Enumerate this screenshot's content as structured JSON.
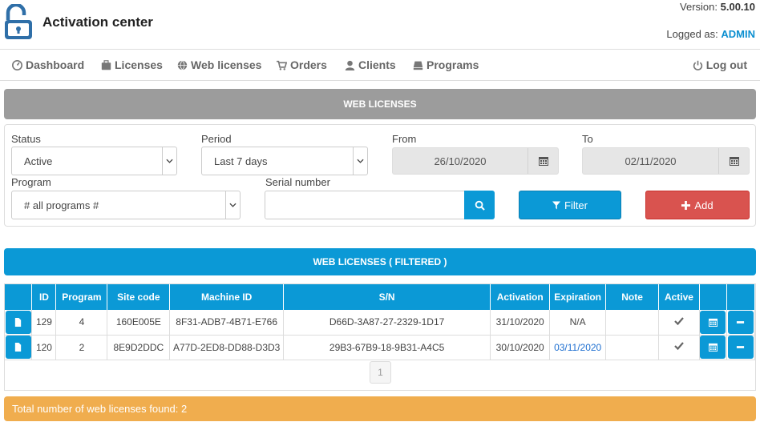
{
  "header": {
    "app_title": "Activation center",
    "version_label": "Version:",
    "version_value": "5.00.10",
    "logged_label": "Logged as:",
    "logged_user": "ADMIN"
  },
  "nav": {
    "dashboard": "Dashboard",
    "licenses": "Licenses",
    "web_licenses": "Web licenses",
    "orders": "Orders",
    "clients": "Clients",
    "programs": "Programs",
    "logout": "Log out"
  },
  "filter_panel": {
    "title": "WEB LICENSES",
    "status_label": "Status",
    "status_value": "Active",
    "period_label": "Period",
    "period_value": "Last 7 days",
    "from_label": "From",
    "from_value": "26/10/2020",
    "to_label": "To",
    "to_value": "02/11/2020",
    "program_label": "Program",
    "program_value": "# all programs #",
    "serial_label": "Serial number",
    "serial_value": "",
    "filter_button": "Filter",
    "add_button": "Add"
  },
  "results": {
    "title": "WEB LICENSES ( FILTERED )",
    "columns": [
      "ID",
      "Program",
      "Site code",
      "Machine ID",
      "S/N",
      "Activation",
      "Expiration",
      "Note",
      "Active"
    ],
    "rows": [
      {
        "id": "129",
        "program": "4",
        "site_code": "160E005E",
        "machine_id": "8F31-ADB7-4B71-E766",
        "sn": "D66D-3A87-27-2329-1D17",
        "activation": "31/10/2020",
        "expiration": "N/A",
        "note": "",
        "active": true
      },
      {
        "id": "120",
        "program": "2",
        "site_code": "8E9D2DDC",
        "machine_id": "A77D-2ED8-DD88-D3D3",
        "sn": "29B3-67B9-18-9B31-A4C5",
        "activation": "30/10/2020",
        "expiration": "03/11/2020",
        "note": "",
        "active": true
      }
    ],
    "page": "1"
  },
  "footer": {
    "total_text": "Total number of web licenses found: 2"
  },
  "colors": {
    "accent": "#0b99d6",
    "danger": "#d9534f",
    "warning": "#f0ad4e",
    "panel_gray": "#9c9c9c"
  }
}
